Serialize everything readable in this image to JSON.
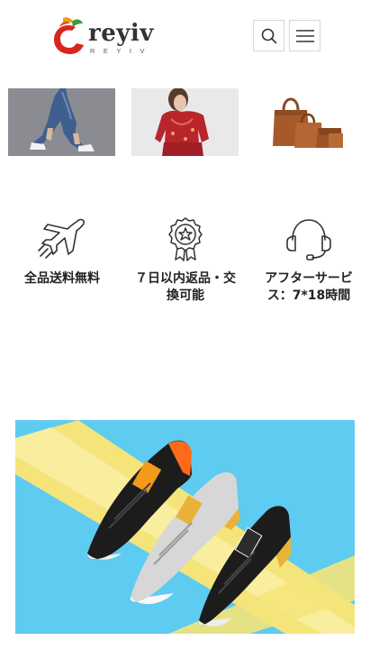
{
  "header": {
    "logo_text": "reyiv",
    "logo_subtext": "REYIV",
    "search_icon": "search-icon",
    "menu_icon": "hamburger-menu-icon"
  },
  "products": [
    {
      "name": "denim-capri-pants"
    },
    {
      "name": "red-floral-blouse"
    },
    {
      "name": "brown-leather-handbag-set"
    }
  ],
  "features": [
    {
      "icon": "airplane-icon",
      "label": "全品送料無料"
    },
    {
      "icon": "award-badge-icon",
      "label": "７日以内返品・交換可能"
    },
    {
      "icon": "headset-icon",
      "label": "アフターサービス：7*18時間"
    }
  ],
  "banner": {
    "name": "sneakers-banner"
  },
  "colors": {
    "logo_red": "#d8261e",
    "logo_orange": "#f39a1b",
    "logo_green": "#3a9d3a",
    "banner_blue": "#5ecbf0",
    "banner_yellow": "#f4e47a"
  }
}
